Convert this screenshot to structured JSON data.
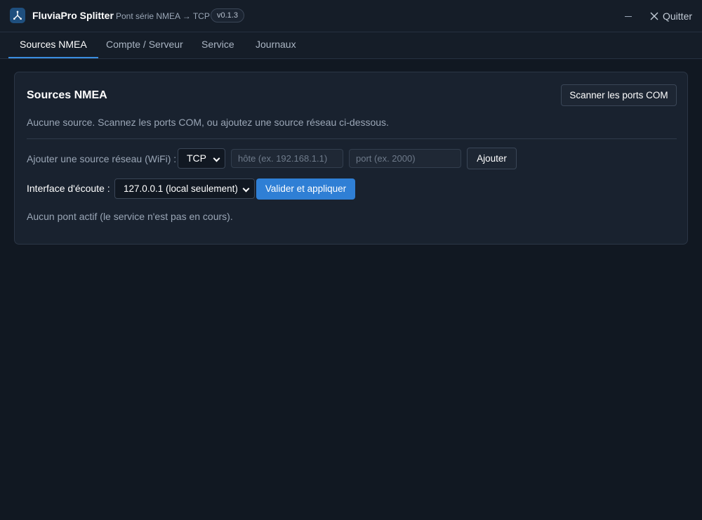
{
  "app": {
    "title": "FluviaPro Splitter",
    "subtitle": "Pont série NMEA → TCP",
    "version": "v0.1.3",
    "logo_icon": "network-fork-icon",
    "quit_label": "Quitter",
    "accent_color": "#2f7fd5"
  },
  "tabs": [
    {
      "label": "Sources NMEA",
      "active": true
    },
    {
      "label": "Compte / Serveur",
      "active": false
    },
    {
      "label": "Service",
      "active": false
    },
    {
      "label": "Journaux",
      "active": false
    }
  ],
  "sources": {
    "title": "Sources NMEA",
    "scan_button": "Scanner les ports COM",
    "empty_message": "Aucune source. Scannez les ports COM, ou ajoutez une source réseau ci-dessous.",
    "network_label": "Ajouter une source réseau (WiFi) :",
    "protocol_value": "TCP",
    "host_value": "",
    "host_placeholder": "hôte (ex. 192.168.1.1)",
    "port_value": "",
    "port_placeholder": "port (ex. 2000)",
    "add_button": "Ajouter",
    "listen_label": "Interface d'écoute :",
    "listen_value": "127.0.0.1 (local seulement)",
    "apply_button": "Valider et appliquer",
    "bridge_status": "Aucun pont actif (le service n'est pas en cours)."
  }
}
